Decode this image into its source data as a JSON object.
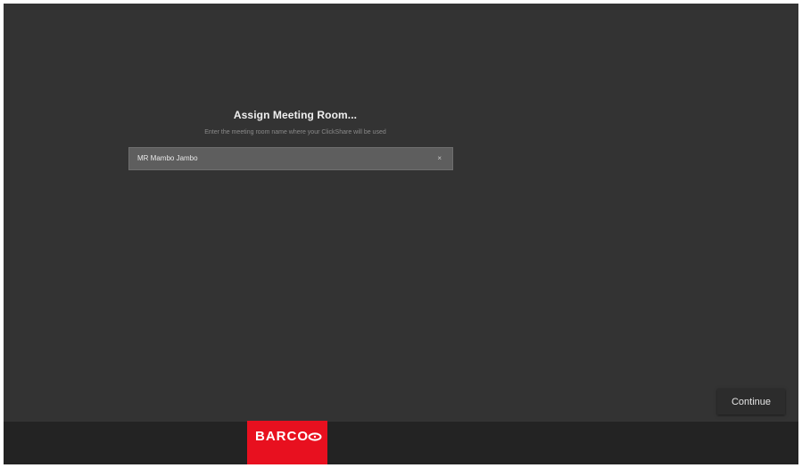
{
  "dialog": {
    "title": "Assign Meeting Room...",
    "subtitle": "Enter the meeting room name where your ClickShare will be used",
    "room_input": {
      "value": "MR Mambo Jambo",
      "clear_icon": "×"
    }
  },
  "actions": {
    "continue_label": "Continue"
  },
  "footer": {
    "logo_text": "BARCO",
    "logo_color": "#e8101f"
  },
  "colors": {
    "background": "#333333",
    "footer": "#232323",
    "field": "#5e5e5e"
  }
}
